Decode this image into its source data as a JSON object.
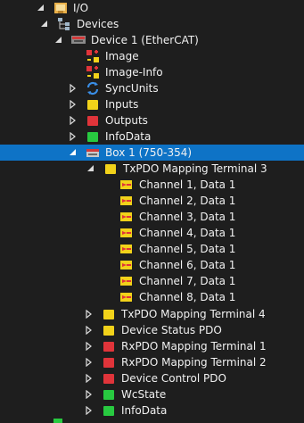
{
  "tree": {
    "io": "I/O",
    "devices": "Devices",
    "device1": "Device 1 (EtherCAT)",
    "image": "Image",
    "image_info": "Image-Info",
    "syncunits": "SyncUnits",
    "inputs": "Inputs",
    "outputs": "Outputs",
    "infodata": "InfoData",
    "box1": "Box 1 (750-354)",
    "txpdo3": "TxPDO Mapping Terminal 3",
    "channels": [
      "Channel 1, Data 1",
      "Channel 2, Data 1",
      "Channel 3, Data 1",
      "Channel 4, Data 1",
      "Channel 5, Data 1",
      "Channel 6, Data 1",
      "Channel 7, Data 1",
      "Channel 8, Data 1"
    ],
    "txpdo4": "TxPDO Mapping Terminal 4",
    "device_status": "Device Status PDO",
    "rxpdo1": "RxPDO Mapping Terminal 1",
    "rxpdo2": "RxPDO Mapping Terminal 2",
    "device_control": "Device Control PDO",
    "wcstate": "WcState",
    "box_infodata": "InfoData"
  },
  "colors": {
    "background": "#1e1e1e",
    "selection": "#0e73c6",
    "input_yellow": "#f2d21a",
    "output_red": "#e0343a",
    "info_green": "#28c940"
  }
}
